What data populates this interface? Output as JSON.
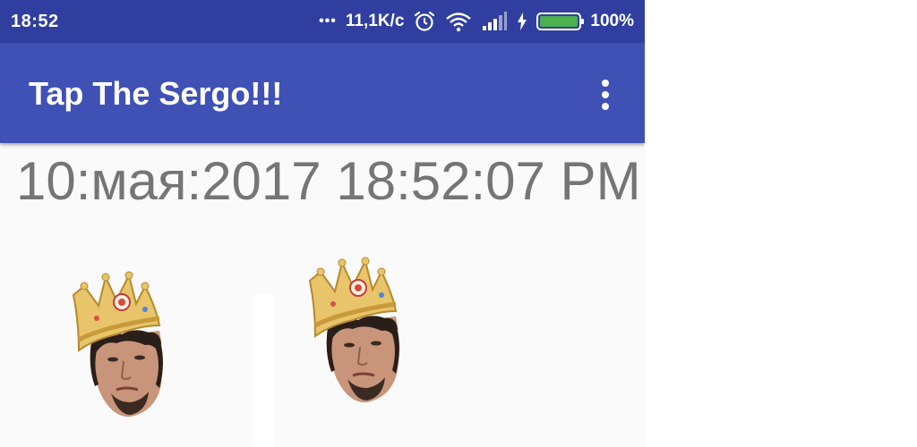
{
  "status_bar": {
    "time": "18:52",
    "dots": "•••",
    "network_speed": "11,1K/c",
    "battery_percent": "100%",
    "battery_level": 1.0,
    "icons": [
      "alarm-icon",
      "wifi-icon",
      "signal-icon",
      "charging-icon",
      "battery-icon"
    ]
  },
  "app_bar": {
    "title": "Tap The Sergo!!!",
    "menu_icon": "overflow-menu-icon"
  },
  "content": {
    "datetime": "10:мая:2017 18:52:07 PM",
    "images": [
      {
        "name": "sergo-crown-image",
        "icon": "crowned-face"
      },
      {
        "name": "sergo-crown-image",
        "icon": "crowned-face"
      }
    ]
  },
  "colors": {
    "status_bar": "#303f9f",
    "app_bar": "#3f51b5",
    "background": "#fafafa",
    "clock_text": "#757575",
    "battery_fill": "#4caf50"
  }
}
